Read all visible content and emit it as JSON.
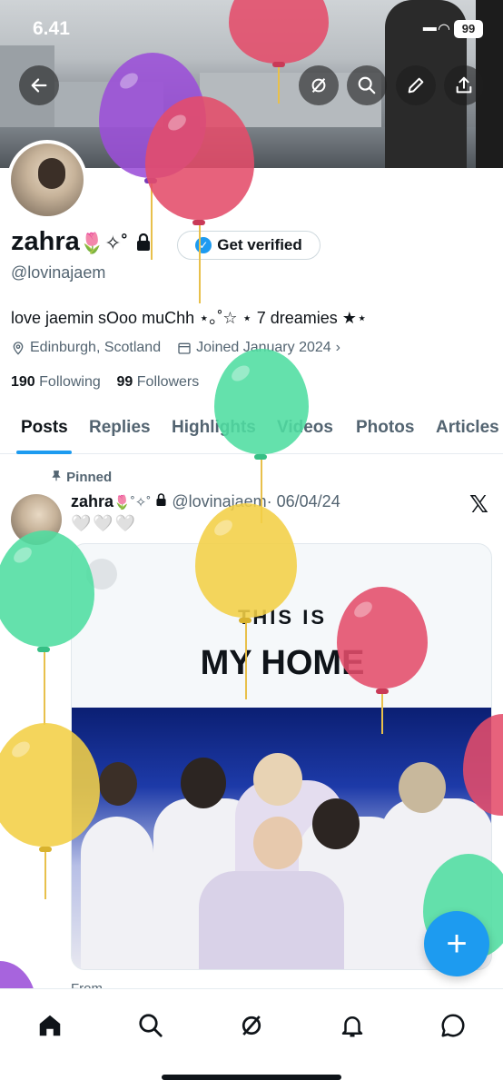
{
  "status": {
    "time": "6.41",
    "battery": "99"
  },
  "profile": {
    "name": "zahra",
    "name_emoji": "🌷✧˚",
    "verify_label": "Get verified",
    "handle": "@lovinajaem",
    "bio": "love jaemin sOoo muChh ⋆｡˚☆ ⋆ 7 dreamies ★⋆",
    "location": "Edinburgh, Scotland",
    "joined": "Joined January 2024",
    "following_count": "190",
    "following_label": "Following",
    "followers_count": "99",
    "followers_label": "Followers"
  },
  "tabs": [
    "Posts",
    "Replies",
    "Highlights",
    "Videos",
    "Photos",
    "Articles"
  ],
  "tweet": {
    "pinned_label": "Pinned",
    "name": "zahra",
    "name_emoji": "🌷˚✧˚",
    "handle": "@lovinajaem",
    "date": "· 06/04/24",
    "hearts": "🤍🤍🤍",
    "card_line1": "THIS IS",
    "card_line2": "MY HOME",
    "from_label": "From"
  },
  "icons": {
    "back": "back-arrow-icon",
    "grok": "grok-icon",
    "search": "search-icon",
    "edit": "pencil-icon",
    "share": "share-icon",
    "home": "home-icon",
    "explore": "search-icon",
    "notifications": "bell-icon",
    "messages": "chat-icon",
    "compose": "plus-icon"
  },
  "colors": {
    "accent": "#1d9bf0",
    "balloon_red": "#e44c6a",
    "balloon_purple": "#9b4fd8",
    "balloon_green": "#4fdda0",
    "balloon_yellow": "#f2cf46"
  }
}
